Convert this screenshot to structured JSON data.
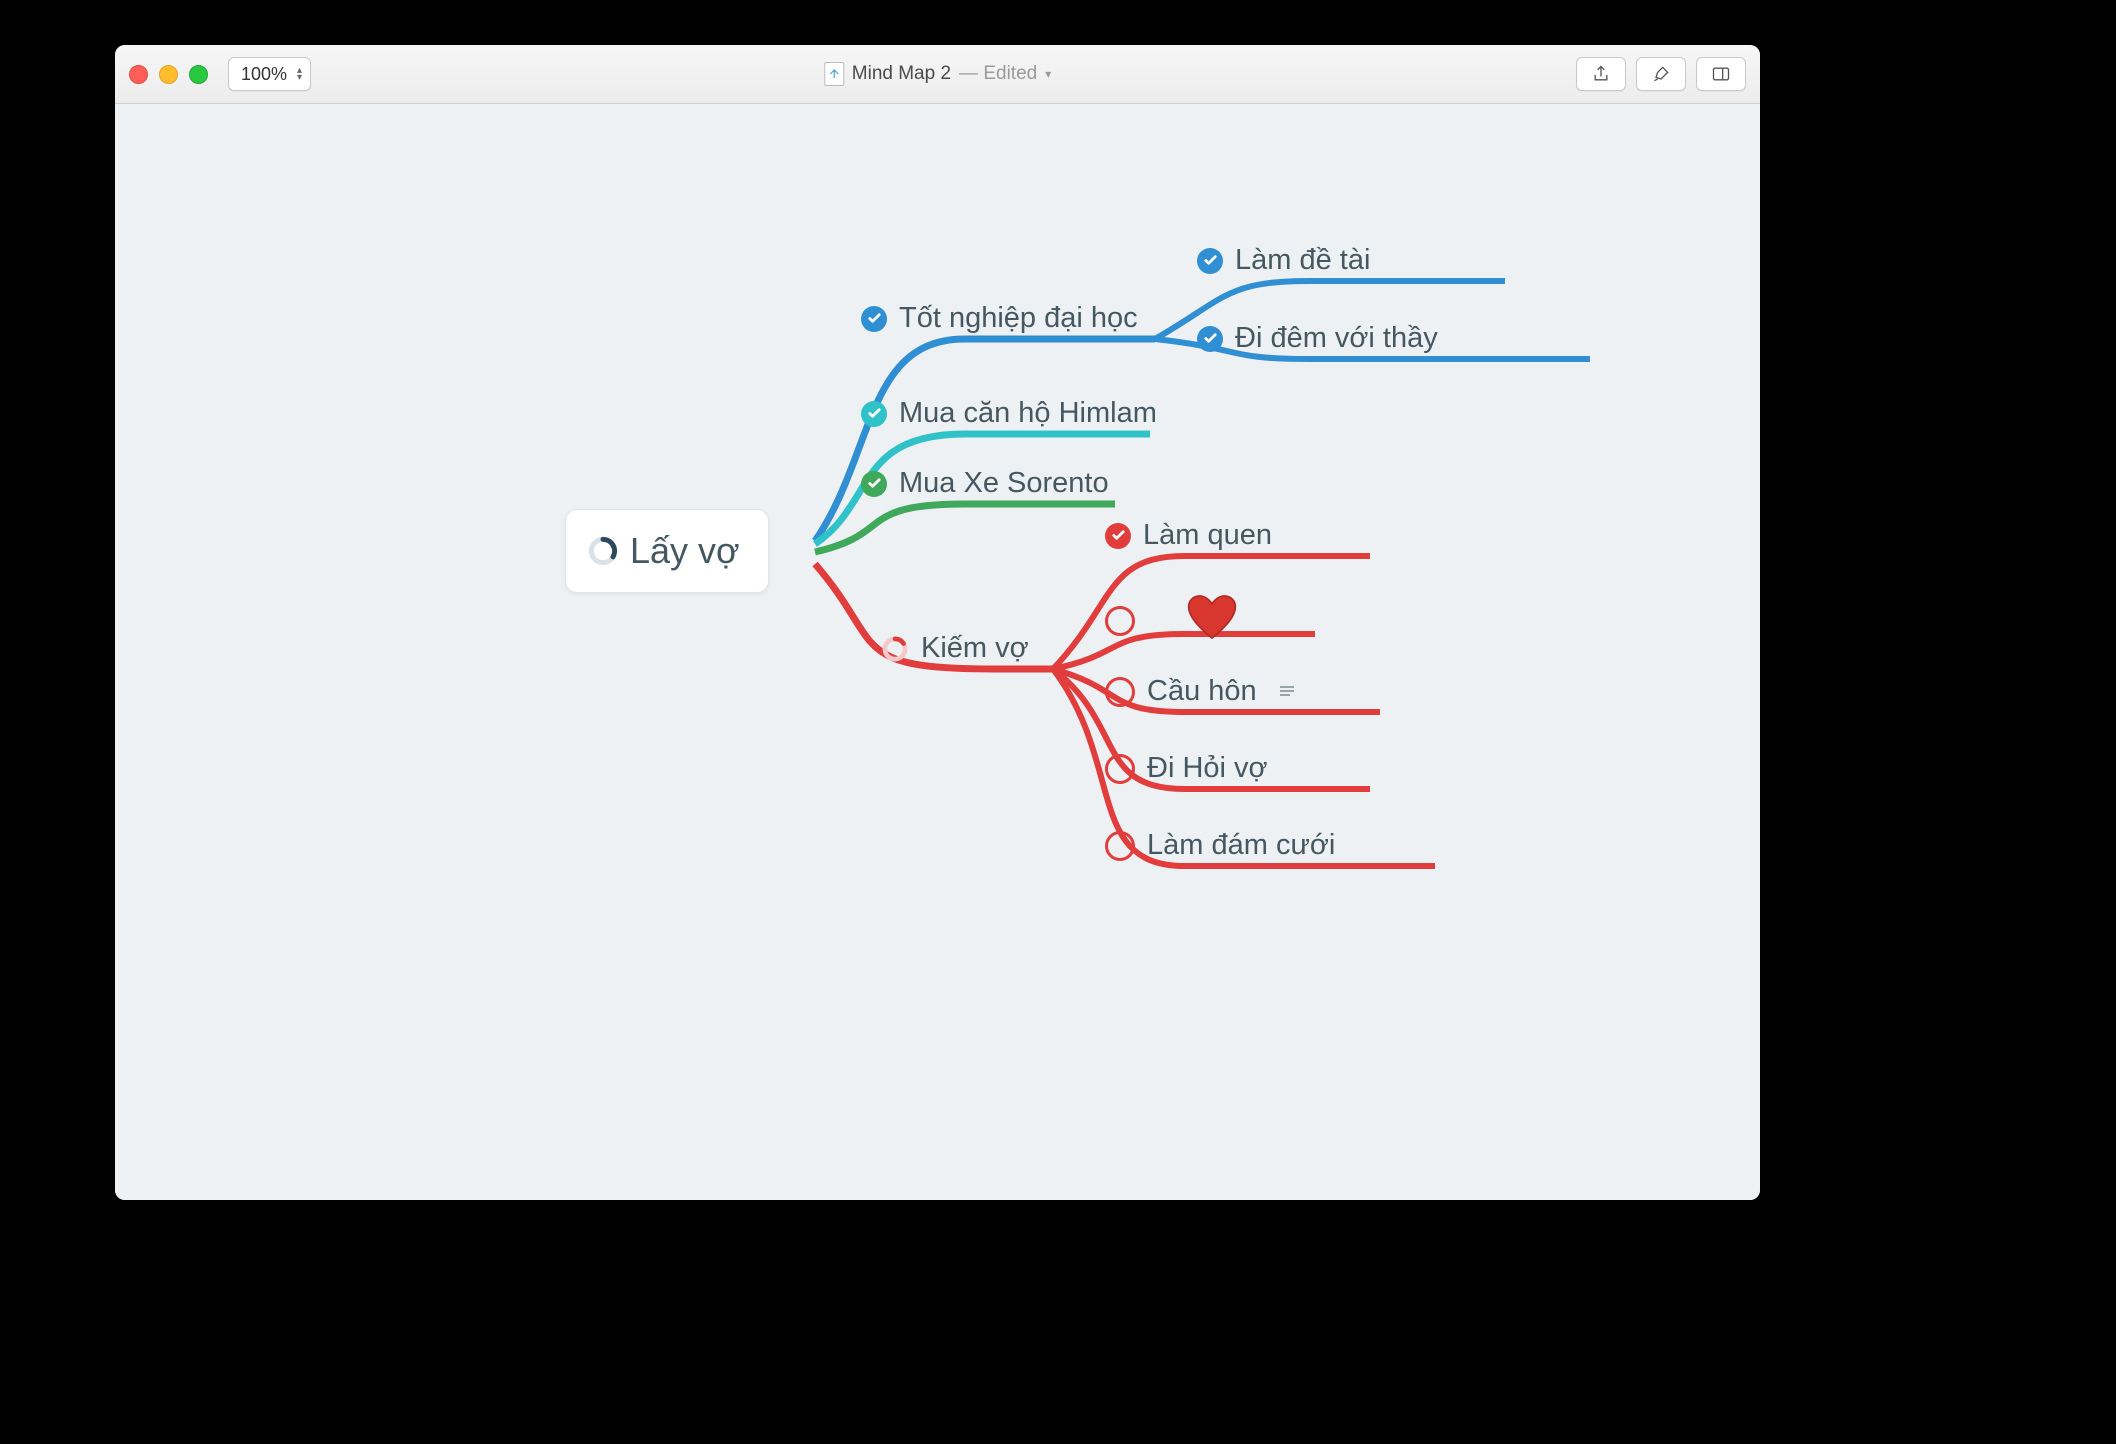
{
  "window": {
    "zoom": "100%",
    "title": "Mind Map 2",
    "status": "Edited"
  },
  "colors": {
    "blue": "#2f8fd2",
    "teal": "#2fc3c9",
    "green": "#3fa85b",
    "red": "#e13d3d",
    "text": "#455862"
  },
  "root": {
    "label": "Lấy vợ",
    "progress_state": "partial"
  },
  "branches": {
    "b1": {
      "label": "Tốt nghiệp đại học",
      "color": "blue",
      "check": "done",
      "children": {
        "c1": {
          "label": "Làm đề tài",
          "check": "done"
        },
        "c2": {
          "label": "Đi đêm với thầy",
          "check": "done"
        }
      }
    },
    "b2": {
      "label": "Mua căn hộ Himlam",
      "color": "teal",
      "check": "done"
    },
    "b3": {
      "label": "Mua Xe Sorento",
      "color": "green",
      "check": "done"
    },
    "b4": {
      "label": "Kiếm vợ",
      "color": "red",
      "check": "partial",
      "children": {
        "k1": {
          "label": "Làm quen",
          "check": "done"
        },
        "k2": {
          "label": "",
          "check": "todo",
          "icon": "heart"
        },
        "k3": {
          "label": "Cầu hôn",
          "check": "todo",
          "has_note": true
        },
        "k4": {
          "label": "Đi Hỏi vợ",
          "check": "todo"
        },
        "k5": {
          "label": "Làm đám cưới",
          "check": "todo"
        }
      }
    }
  }
}
